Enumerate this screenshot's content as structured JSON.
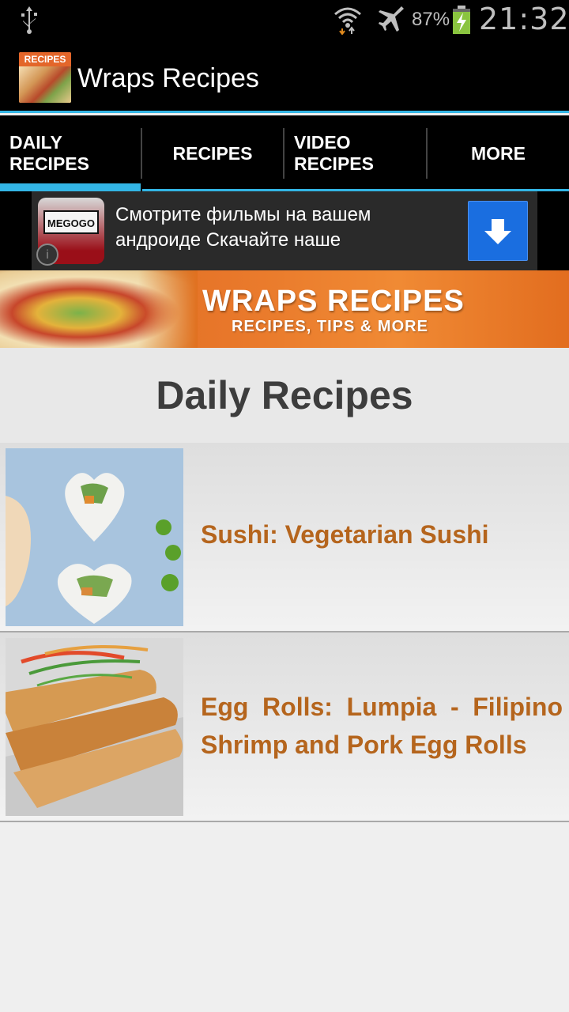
{
  "status_bar": {
    "battery_percent": "87%",
    "time": "21:32",
    "icons": [
      "usb-icon",
      "wifi-icon",
      "airplane-mode-icon",
      "battery-charging-icon"
    ]
  },
  "app": {
    "title": "Wraps Recipes",
    "icon_label": "RECIPES"
  },
  "tabs": [
    {
      "line1": "DAILY",
      "line2": "RECIPES",
      "selected": true
    },
    {
      "line1": "RECIPES",
      "line2": ""
    },
    {
      "line1": "VIDEO",
      "line2": "RECIPES"
    },
    {
      "line1": "MORE",
      "line2": ""
    }
  ],
  "ad": {
    "brand": "MEGOGO",
    "text": "Смотрите фильмы на вашем андроиде Скачайте наше",
    "icons": [
      "info-icon",
      "download-icon"
    ]
  },
  "banner": {
    "title": "WRAPS RECIPES",
    "subtitle": "RECIPES, TIPS & MORE"
  },
  "section_title": "Daily Recipes",
  "recipes": [
    {
      "title": "Sushi: Vegetarian Sushi"
    },
    {
      "title": "Egg Rolls: Lumpia - Filipino Shrimp and Pork Egg Rolls"
    }
  ],
  "colors": {
    "accent": "#33b5e5",
    "recipe_title": "#b5651d",
    "banner_orange": "#e8772a"
  }
}
